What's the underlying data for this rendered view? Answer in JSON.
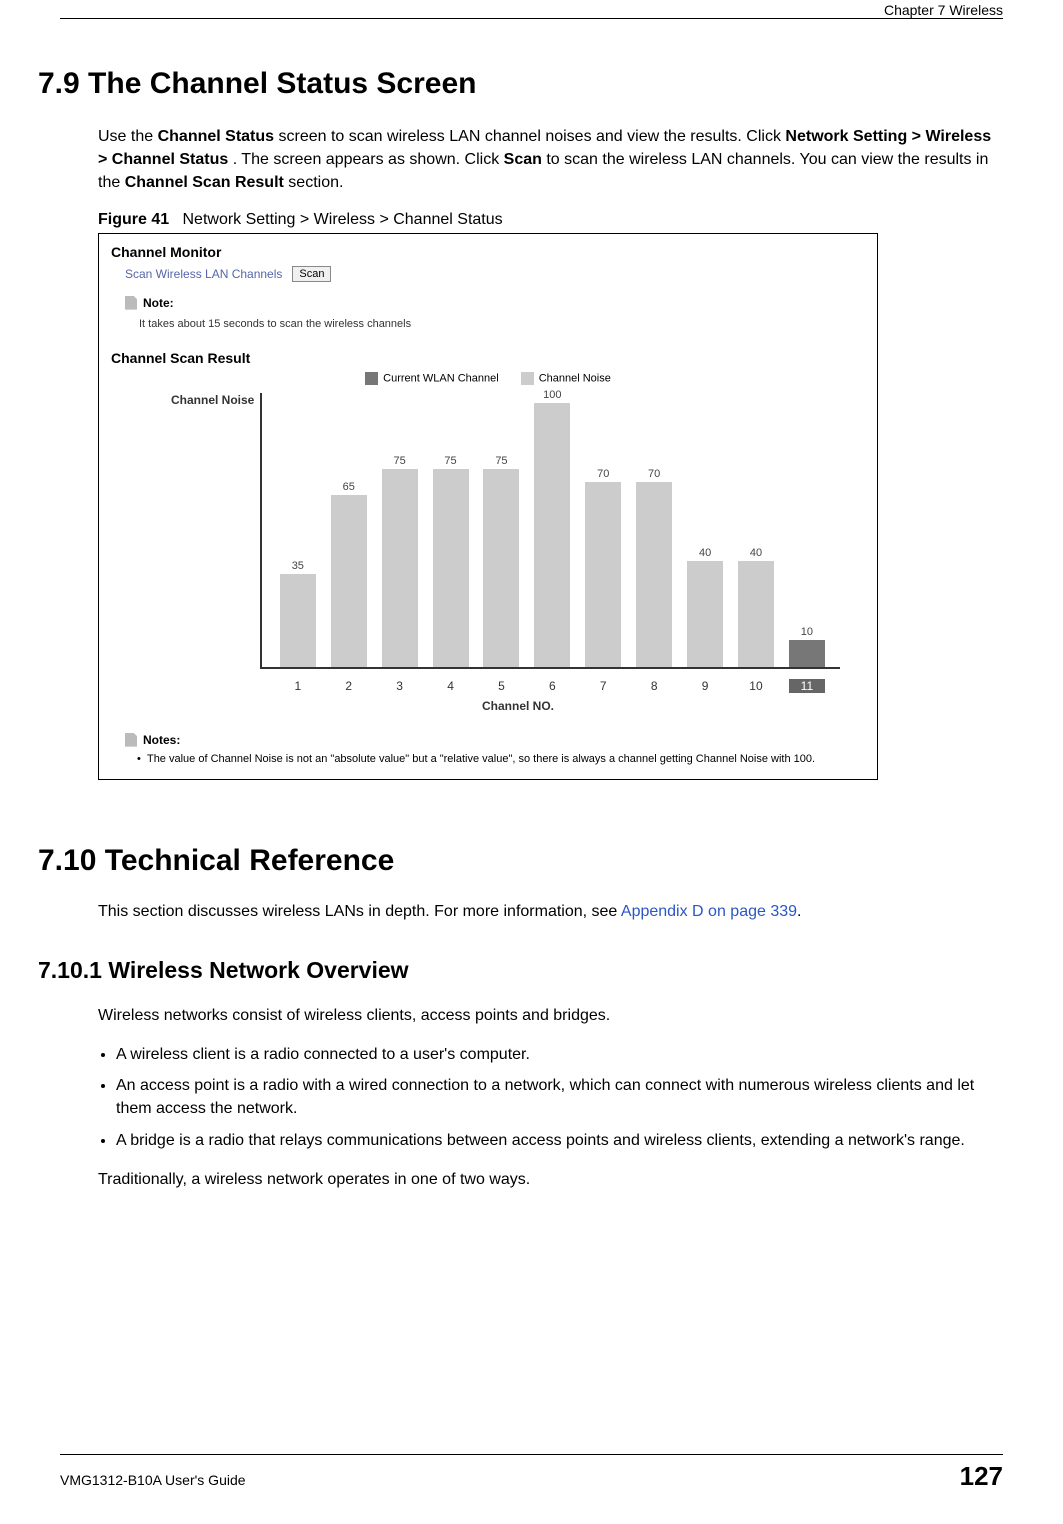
{
  "header": {
    "chapter": "Chapter 7 Wireless"
  },
  "s79": {
    "heading": "7.9  The Channel Status Screen",
    "p": [
      "Use the ",
      "Channel Status",
      " screen to scan wireless LAN channel noises and view the results. Click ",
      "Network Setting > Wireless > Channel Status",
      ". The screen appears as shown. Click ",
      "Scan",
      " to scan the wireless LAN channels. You can view the results in the ",
      "Channel Scan Result",
      " section."
    ],
    "figure": {
      "label": "Figure 41",
      "title": "Network Setting > Wireless > Channel Status"
    }
  },
  "fig": {
    "monitor_title": "Channel Monitor",
    "scan_label": "Scan Wireless LAN Channels",
    "scan_button": "Scan",
    "note_label": "Note:",
    "note_text": "It takes about 15 seconds to scan the wireless channels",
    "result_title": "Channel Scan Result",
    "notes_label": "Notes:",
    "notes_bullet": "The value of Channel Noise is not an \"absolute value\" but a \"relative value\", so there is always a channel getting Channel Noise with 100."
  },
  "chart_data": {
    "type": "bar",
    "title": "",
    "xlabel": "Channel NO.",
    "ylabel": "Channel Noise",
    "ylim": [
      0,
      100
    ],
    "categories": [
      "1",
      "2",
      "3",
      "4",
      "5",
      "6",
      "7",
      "8",
      "9",
      "10",
      "11"
    ],
    "values": [
      35,
      65,
      75,
      75,
      75,
      100,
      70,
      70,
      40,
      40,
      10
    ],
    "current_index": 10,
    "legend": [
      "Current WLAN Channel",
      "Channel Noise"
    ],
    "colors": {
      "current": "#777777",
      "noise": "#cccccc"
    }
  },
  "s710": {
    "heading": "7.10  Technical Reference",
    "p": [
      "This section discusses wireless LANs in depth. For more information, see ",
      "Appendix D on page 339",
      "."
    ]
  },
  "s7101": {
    "heading": "7.10.1  Wireless Network Overview",
    "intro": "Wireless networks consist of wireless clients, access points and bridges.",
    "bullets": [
      "A wireless client is a radio connected to a user's computer.",
      "An access point is a radio with a wired connection to a network, which can connect with numerous wireless clients and let them access the network.",
      "A bridge is a radio that relays communications between access points and wireless clients, extending a network's range."
    ],
    "closing": "Traditionally, a wireless network operates in one of two ways."
  },
  "footer": {
    "guide": "VMG1312-B10A User's Guide",
    "page": "127"
  }
}
